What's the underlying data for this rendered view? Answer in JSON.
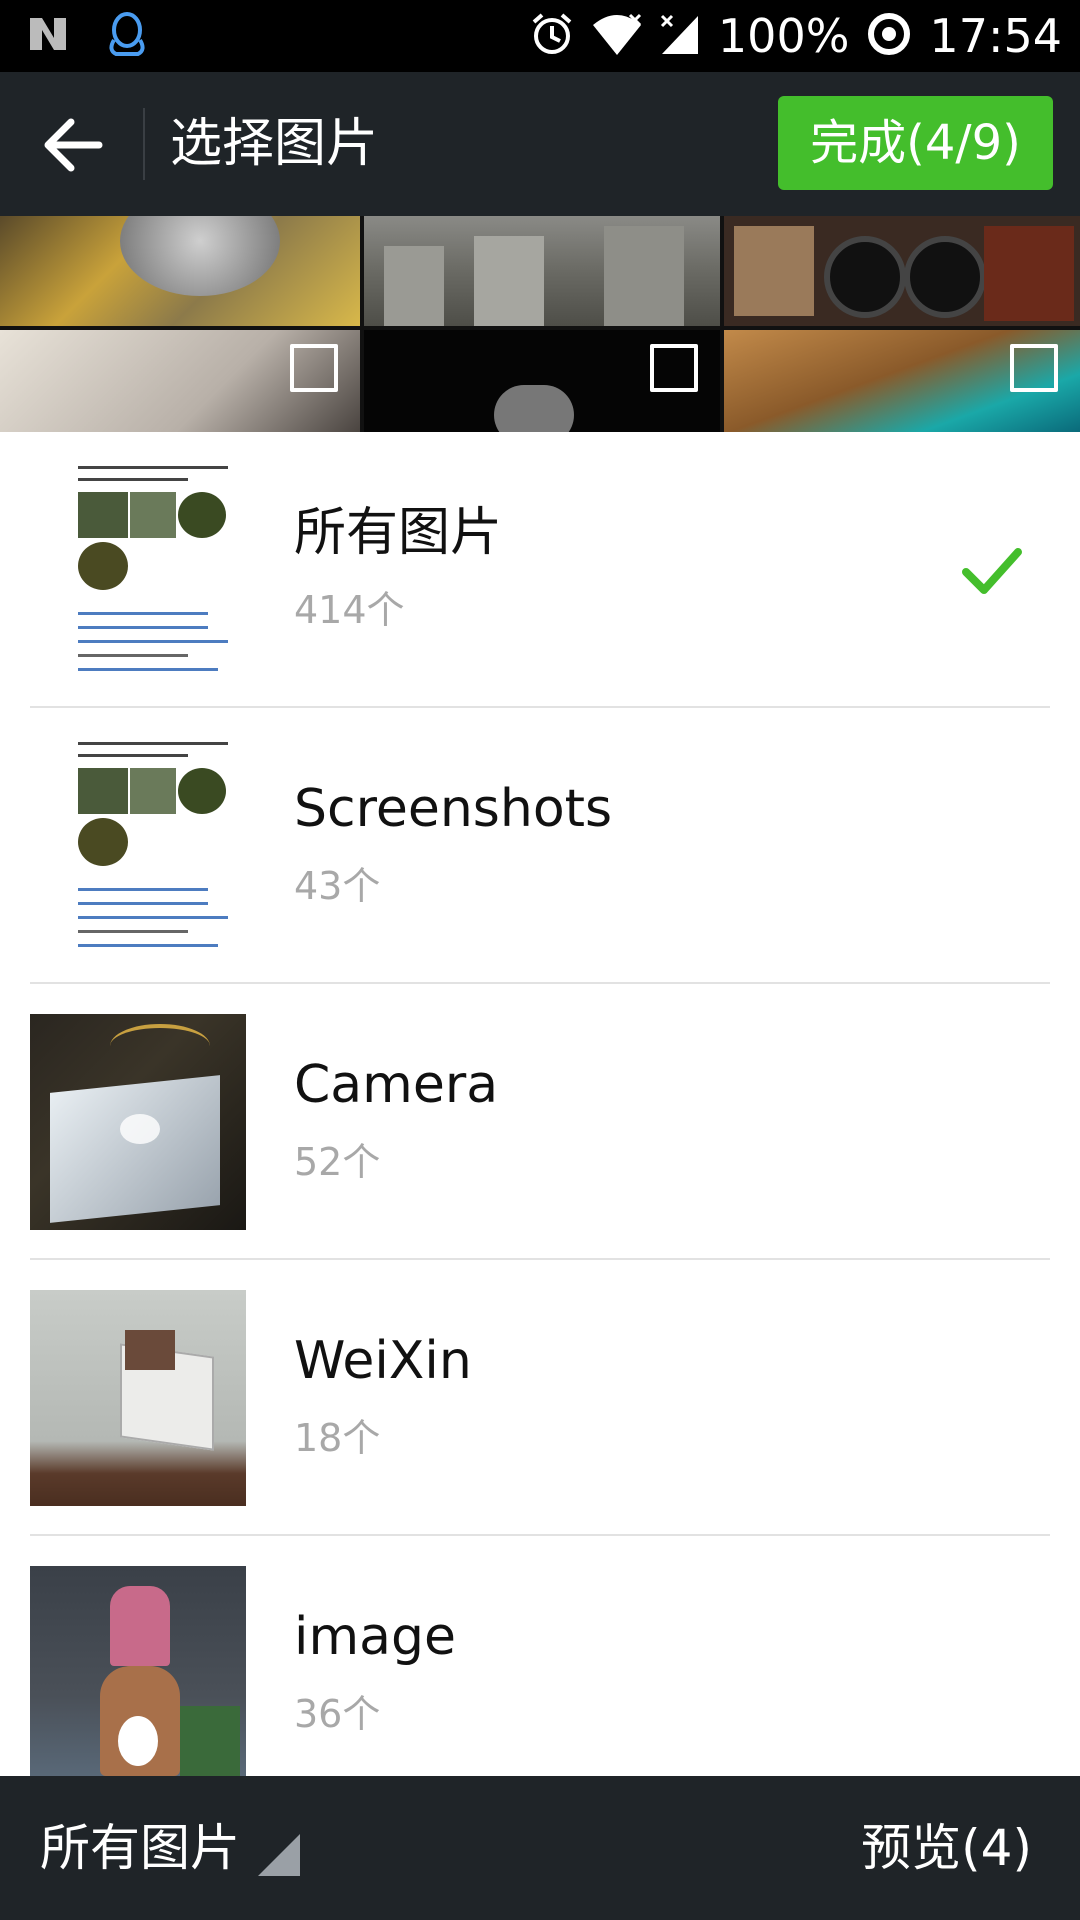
{
  "status_bar": {
    "battery": "100%",
    "time": "17:54",
    "icons": [
      "n-logo-icon",
      "qq-penguin-icon",
      "alarm-icon",
      "wifi-icon",
      "signal-icon",
      "sync-ring-icon"
    ]
  },
  "header": {
    "back_icon": "arrow-left-icon",
    "title": "选择图片",
    "done_label": "完成(4/9)"
  },
  "albums": [
    {
      "name": "所有图片",
      "count": "414个",
      "selected": true
    },
    {
      "name": "Screenshots",
      "count": "43个",
      "selected": false
    },
    {
      "name": "Camera",
      "count": "52个",
      "selected": false
    },
    {
      "name": "WeiXin",
      "count": "18个",
      "selected": false
    },
    {
      "name": "image",
      "count": "36个",
      "selected": false
    }
  ],
  "footer": {
    "folder_label": "所有图片",
    "preview_label": "预览(4)"
  },
  "colors": {
    "accent": "#44be2c",
    "bar_bg": "#1f2428",
    "count_text": "#a8a8a8"
  }
}
